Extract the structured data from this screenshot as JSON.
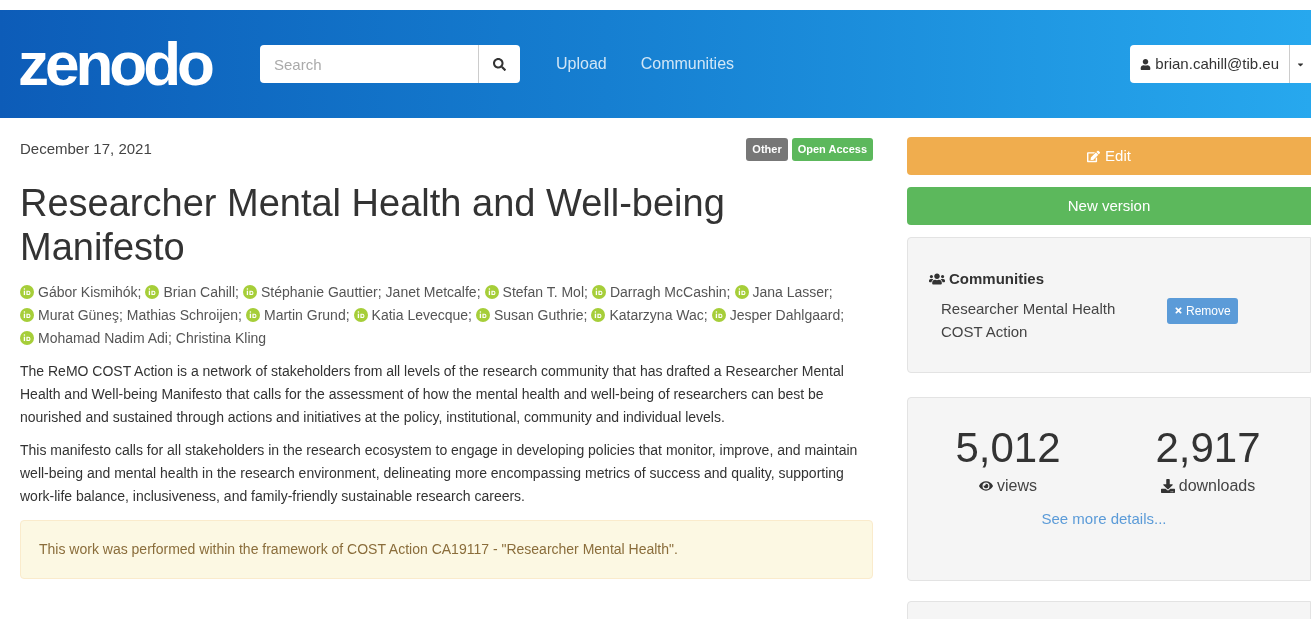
{
  "navbar": {
    "logo": "zenodo",
    "search": {
      "placeholder": "Search"
    },
    "links": [
      "Upload",
      "Communities"
    ],
    "user": "brian.cahill@tib.eu"
  },
  "record": {
    "date": "December 17, 2021",
    "badges": [
      {
        "label": "Other",
        "color": "#777777"
      },
      {
        "label": "Open Access",
        "color": "#5cb85c"
      }
    ],
    "title": "Researcher Mental Health and Well-being Manifesto",
    "authors": [
      {
        "name": "Gábor Kismihók;",
        "orcid": true
      },
      {
        "name": "Brian Cahill;",
        "orcid": true
      },
      {
        "name": "Stéphanie Gauttier;",
        "orcid": true
      },
      {
        "name": "Janet Metcalfe;",
        "orcid": false
      },
      {
        "name": "Stefan T. Mol;",
        "orcid": true
      },
      {
        "name": "Darragh McCashin;",
        "orcid": true
      },
      {
        "name": "Jana Lasser;",
        "orcid": true
      },
      {
        "name": "Murat Güneş;",
        "orcid": true
      },
      {
        "name": "Mathias Schroijen;",
        "orcid": false
      },
      {
        "name": "Martin Grund;",
        "orcid": true
      },
      {
        "name": "Katia Levecque;",
        "orcid": true
      },
      {
        "name": "Susan Guthrie;",
        "orcid": true
      },
      {
        "name": "Katarzyna Wac;",
        "orcid": true
      },
      {
        "name": "Jesper Dahlgaard;",
        "orcid": true
      },
      {
        "name": "Mohamad Nadim Adi;",
        "orcid": true
      },
      {
        "name": "Christina Kling",
        "orcid": false
      }
    ],
    "paragraphs": [
      "The ReMO COST Action is a network of stakeholders from all levels of the research community that has drafted a Researcher Mental Health and Well-being Manifesto that calls for the assessment of how the mental health and well-being of researchers can best be nourished and sustained through actions and initiatives at the policy, institutional, community and individual levels.",
      "This manifesto calls for all stakeholders in the research ecosystem to engage in developing policies that monitor, improve, and maintain well-being and mental health in the research environment, delineating more encompassing metrics of success and quality, supporting work-life balance, inclusiveness, and family-friendly sustainable research careers."
    ],
    "notice": "This work was performed within the framework of COST Action CA19117 - \"Researcher Mental Health\"."
  },
  "sidebar": {
    "edit_button": "Edit",
    "new_version_button": "New version",
    "communities": {
      "heading": "Communities",
      "items": [
        {
          "name": "Researcher Mental Health COST Action",
          "action": "Remove"
        }
      ]
    },
    "stats": [
      {
        "kind": "views",
        "value": "5,012",
        "label": "views"
      },
      {
        "kind": "downloads",
        "value": "2,917",
        "label": "downloads"
      }
    ],
    "details_link": "See more details..."
  }
}
